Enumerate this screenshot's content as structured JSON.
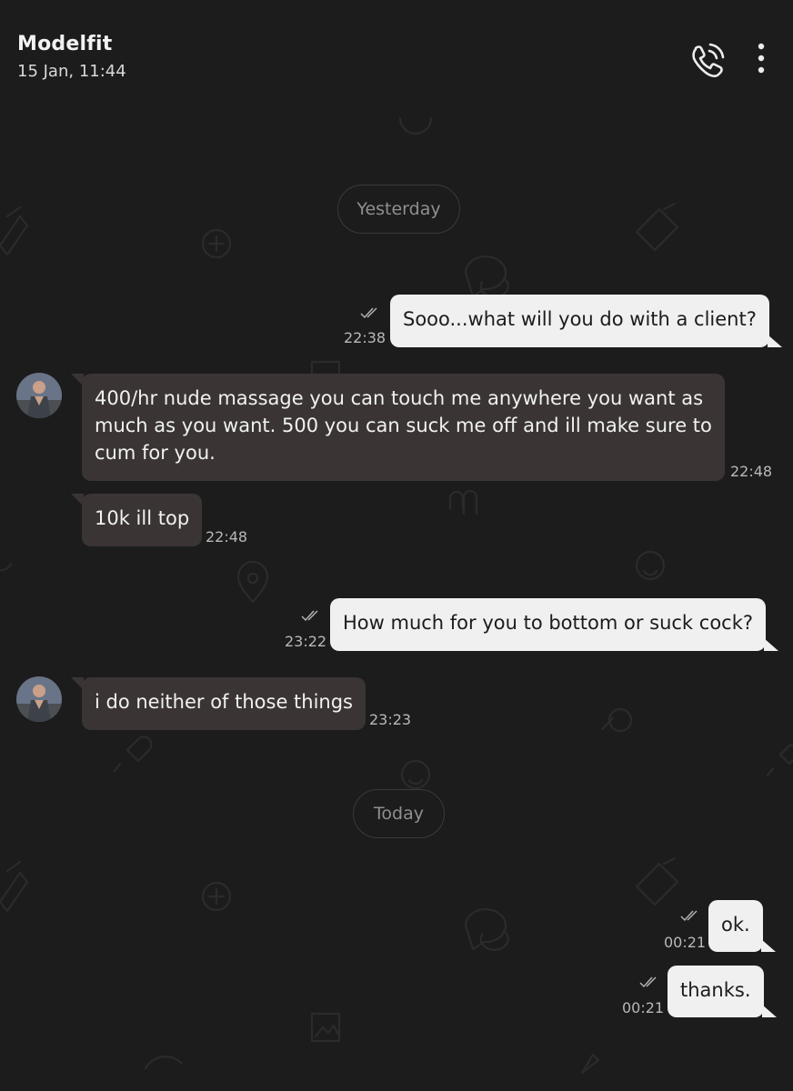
{
  "header": {
    "title": "Modelfit",
    "subtitle": "15 Jan, 11:44",
    "call_icon": "phone-call-icon",
    "menu_icon": "more-vertical-icon"
  },
  "colors": {
    "background": "#1c1c1c",
    "outgoing_bubble": "#f0f0f0",
    "incoming_bubble": "#3a3534",
    "timestamp": "#b8b8b8"
  },
  "day_separators": [
    "Yesterday",
    "Today"
  ],
  "messages": [
    {
      "direction": "out",
      "text": "Sooo...what will you do with a client?",
      "time": "22:38",
      "read": true
    },
    {
      "direction": "in",
      "lines": [
        "400/hr nude massage you can touch me anywhere you want as",
        "much as you want. 500 you can suck me off and ill make sure to",
        "cum for you."
      ],
      "time": "22:48"
    },
    {
      "direction": "in",
      "text": "10k ill top",
      "time": "22:48"
    },
    {
      "direction": "out",
      "text": "How much for you to bottom or suck cock?",
      "time": "23:22",
      "read": true
    },
    {
      "direction": "in",
      "text": "i do neither of those things",
      "time": "23:23"
    },
    {
      "direction": "out",
      "text": "ok.",
      "time": "00:21",
      "read": true
    },
    {
      "direction": "out",
      "text": "thanks.",
      "time": "00:21",
      "read": true
    }
  ]
}
